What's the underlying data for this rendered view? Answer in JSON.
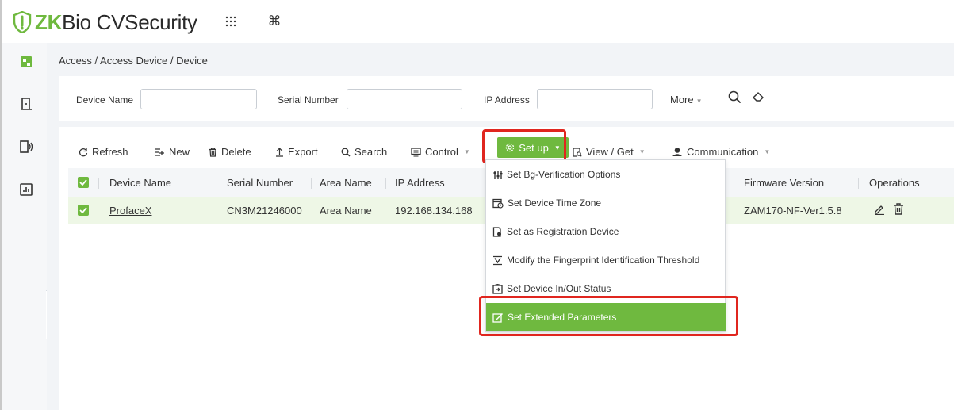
{
  "app": {
    "logo_brand": "ZK",
    "logo_rest": "Bio CVSecurity",
    "header_icons": [
      "grid-dots-icon",
      "command-icon"
    ]
  },
  "sidebar": {
    "icons": [
      "personnel-icon",
      "access-door-icon",
      "door-device-icon",
      "report-chart-icon"
    ],
    "collapse_label": "»"
  },
  "breadcrumb": "Access / Access Device / Device",
  "search": {
    "device_name_label": "Device Name",
    "serial_number_label": "Serial Number",
    "ip_address_label": "IP Address",
    "device_name_value": "",
    "serial_number_value": "",
    "ip_address_value": "",
    "more_label": "More"
  },
  "toolbar": {
    "refresh": "Refresh",
    "new": "New",
    "delete": "Delete",
    "export": "Export",
    "search": "Search",
    "control": "Control",
    "setup": "Set up",
    "view_get": "View / Get",
    "communication": "Communication"
  },
  "table": {
    "columns": {
      "device_name": "Device Name",
      "serial_number": "Serial Number",
      "area_name": "Area Name",
      "ip_address": "IP Address",
      "firmware_version": "Firmware Version",
      "operations": "Operations"
    },
    "rows": [
      {
        "device_name": "ProfaceX",
        "serial_number": "CN3M21246000",
        "area_name": "Area Name",
        "ip_address": "192.168.134.168",
        "firmware_version": "ZAM170-NF-Ver1.5.8"
      }
    ]
  },
  "setup_menu": {
    "items": [
      "Set Bg-Verification Options",
      "Set Device Time Zone",
      "Set as Registration Device",
      "Modify the Fingerprint Identification Threshold",
      "Set Device In/Out Status",
      "Set Extended Parameters"
    ],
    "active_index": 5
  },
  "colors": {
    "brand_green": "#6fb93f",
    "highlight_red": "#e0261f",
    "selected_row": "#eef7e6"
  }
}
